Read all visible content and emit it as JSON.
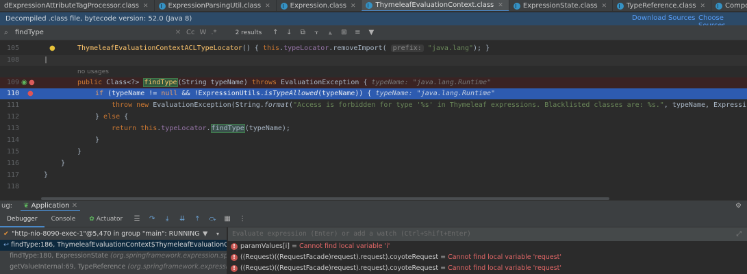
{
  "tabs": [
    {
      "label": "dExpressionAttributeTagProcessor.class",
      "active": false
    },
    {
      "label": "ExpressionParsingUtil.class",
      "active": false
    },
    {
      "label": "Expression.class",
      "active": false
    },
    {
      "label": "ThymeleafEvaluationContext.class",
      "active": true
    },
    {
      "label": "ExpressionState.class",
      "active": false
    },
    {
      "label": "TypeReference.class",
      "active": false
    },
    {
      "label": "CompoundExpression.class",
      "active": false
    }
  ],
  "decompiled": {
    "message": "Decompiled .class file, bytecode version: 52.0 (Java 8)",
    "download_label": "Download Sources",
    "choose_label": "Choose Sources"
  },
  "search": {
    "query": "findType",
    "case_label": "Cc",
    "words_label": "W",
    "regex_label": ".*",
    "results": "2 results"
  },
  "code_lines": [
    {
      "num": "105"
    },
    {
      "num": "108"
    },
    {
      "num": ""
    },
    {
      "num": "109"
    },
    {
      "num": "110"
    },
    {
      "num": "111"
    },
    {
      "num": "112"
    },
    {
      "num": "113"
    },
    {
      "num": "114"
    },
    {
      "num": "115"
    },
    {
      "num": "116"
    },
    {
      "num": "117"
    },
    {
      "num": "118"
    }
  ],
  "code": {
    "l105_method": "ThymeleafEvaluationContextACLTypeLocator",
    "l105_rest": "() { ",
    "l105_this": "this",
    "l105_dot": ".",
    "l105_field": "typeLocator",
    "l105_call": ".removeImport( ",
    "l105_chip": "prefix:",
    "l105_str": "\"java.lang\"",
    "l105_end": "); }",
    "no_usages": "no usages",
    "l109_public": "public ",
    "l109_type": "Class<?> ",
    "l109_fn": "findType",
    "l109_params": "(String typeName) ",
    "l109_throws": "throws ",
    "l109_exc": "EvaluationException {",
    "l109_hint": "typeName: \"java.lang.Runtime\"",
    "l110_if": "if ",
    "l110_a": "(typeName != ",
    "l110_null": "null",
    "l110_b": " && !ExpressionUtils.",
    "l110_call": "isTypeAllowed",
    "l110_c": "(typeName)) {",
    "l110_hint": "typeName: \"java.lang.Runtime\"",
    "l111_throw": "throw new ",
    "l111_a": "EvaluationException(String.",
    "l111_format": "format",
    "l111_b": "(",
    "l111_str": "\"Access is forbidden for type '%s' in Thymeleaf expressions. Blacklisted classes are: %s.\"",
    "l111_c": ", typeName, Expressi",
    "l112_a": "} ",
    "l112_else": "else",
    "l112_b": " {",
    "l113_return": "return ",
    "l113_this": "this",
    "l113_dot": ".",
    "l113_field": "typeLocator",
    "l113_dot2": ".",
    "l113_fn": "findType",
    "l113_end": "(typeName);",
    "l114": "}",
    "l115": "}",
    "l116": "}",
    "l117": "}"
  },
  "debug": {
    "prefix": "ug:",
    "app_label": "Application",
    "tab_debugger": "Debugger",
    "tab_console": "Console",
    "tab_actuator": "Actuator",
    "thread": "\"http-nio-8090-exec-1\"@5,470 in group \"main\": RUNNING",
    "frames": [
      {
        "main": "findType:186, ThymeleafEvaluationContext$ThymeleafEvaluationConte",
        "pkg": ""
      },
      {
        "main": "findType:180, ExpressionState ",
        "pkg": "(org.springframework.expression.spel)"
      },
      {
        "main": "getValueInternal:69, TypeReference ",
        "pkg": "(org.springframework.expression.s"
      }
    ],
    "eval_placeholder": "Evaluate expression (Enter) or add a watch (Ctrl+Shift+Enter)",
    "variables": [
      {
        "name": "paramValues[i] = ",
        "msg": "Cannot find local variable 'i'"
      },
      {
        "name": "((Request)((RequestFacade)request).request).coyoteRequest = ",
        "msg": "Cannot find local variable 'request'"
      },
      {
        "name": "((Request)((RequestFacade)request).request).coyoteRequest = ",
        "msg": "Cannot find local variable 'request'"
      }
    ]
  }
}
